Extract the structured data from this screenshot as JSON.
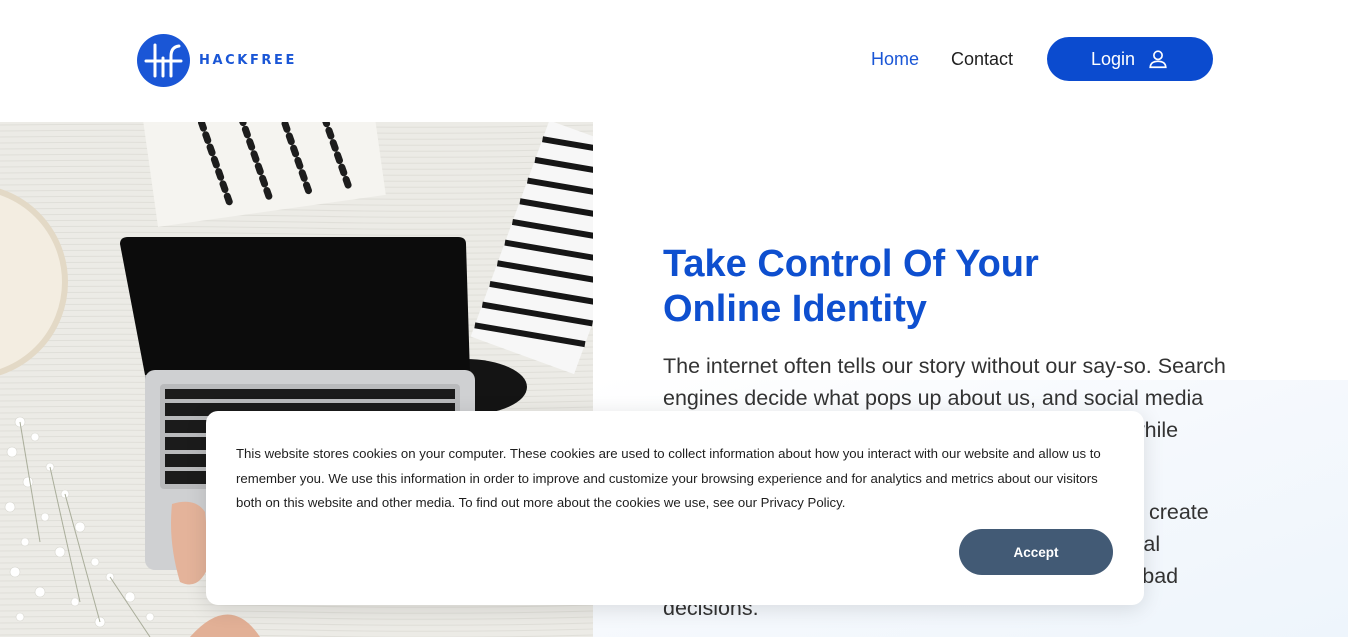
{
  "brand": {
    "name": "HACKFREE",
    "accent_color": "#1a56d6",
    "logo_icon": "hf-logo-icon"
  },
  "nav": {
    "items": [
      {
        "label": "Home",
        "active": true
      },
      {
        "label": "Contact",
        "active": false
      }
    ],
    "login_label": "Login",
    "login_icon": "user-icon"
  },
  "hero": {
    "title_line1": "Take Control Of Your",
    "title_line2": "Online Identity",
    "paragraph1": "The internet often tells our story without our say-so. Search engines decide what pops up about us, and social media companies sell our data to the highest bidder, all while hackers exploit our personal information.",
    "paragraph2": "Worse, online scammers use this data so they can create online profiles for fake identities, identity theft, digital breaches, and deepfakes that trick us into making bad decisions."
  },
  "cookie_banner": {
    "text": "This website stores cookies on your computer. These cookies are used to collect information about how you interact with our website and allow us to remember you. We use this information in order to improve and customize your browsing experience and for analytics and metrics about our visitors both on this website and other media. To find out more about the cookies we use, see our Privacy Policy.",
    "accept_label": "Accept",
    "button_color": "#425a75"
  }
}
